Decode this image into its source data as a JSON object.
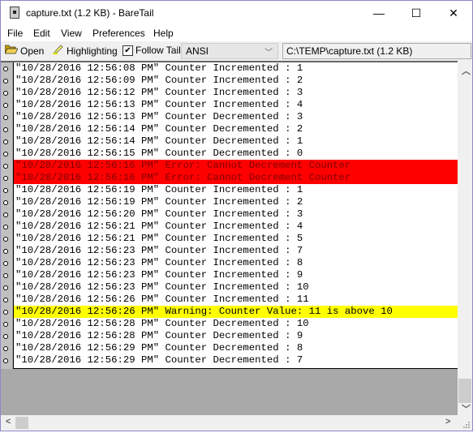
{
  "window": {
    "title": "capture.txt (1.2 KB) - BareTail",
    "minimize": "—",
    "maximize": "☐",
    "close": "✕"
  },
  "menu": [
    "File",
    "Edit",
    "View",
    "Preferences",
    "Help"
  ],
  "toolbar": {
    "open_label": "Open",
    "highlighting_label": "Highlighting",
    "follow_tail_label": "Follow Tail",
    "follow_tail_checked": true,
    "encoding": "ANSI",
    "file_path": "C:\\TEMP\\capture.txt (1.2 KB)"
  },
  "colors": {
    "error_bg": "#ff0000",
    "error_fg": "#800000",
    "warning_bg": "#ffff00"
  },
  "log_lines": [
    {
      "text": "\"10/28/2016 12:56:08 PM\" Counter Incremented : 1",
      "type": "normal"
    },
    {
      "text": "\"10/28/2016 12:56:09 PM\" Counter Incremented : 2",
      "type": "normal"
    },
    {
      "text": "\"10/28/2016 12:56:12 PM\" Counter Incremented : 3",
      "type": "normal"
    },
    {
      "text": "\"10/28/2016 12:56:13 PM\" Counter Incremented : 4",
      "type": "normal"
    },
    {
      "text": "\"10/28/2016 12:56:13 PM\" Counter Decremented : 3",
      "type": "normal"
    },
    {
      "text": "\"10/28/2016 12:56:14 PM\" Counter Decremented : 2",
      "type": "normal"
    },
    {
      "text": "\"10/28/2016 12:56:14 PM\" Counter Decremented : 1",
      "type": "normal"
    },
    {
      "text": "\"10/28/2016 12:56:15 PM\" Counter Decremented : 0",
      "type": "normal"
    },
    {
      "text": "\"10/28/2016 12:56:16 PM\" Error: Cannot Decrement Counter",
      "type": "error"
    },
    {
      "text": "\"10/28/2016 12:56:16 PM\" Error: Cannot Decrement Counter",
      "type": "error"
    },
    {
      "text": "\"10/28/2016 12:56:19 PM\" Counter Incremented : 1",
      "type": "normal"
    },
    {
      "text": "\"10/28/2016 12:56:19 PM\" Counter Incremented : 2",
      "type": "normal"
    },
    {
      "text": "\"10/28/2016 12:56:20 PM\" Counter Incremented : 3",
      "type": "normal"
    },
    {
      "text": "\"10/28/2016 12:56:21 PM\" Counter Incremented : 4",
      "type": "normal"
    },
    {
      "text": "\"10/28/2016 12:56:21 PM\" Counter Incremented : 5",
      "type": "normal"
    },
    {
      "text": "\"10/28/2016 12:56:23 PM\" Counter Incremented : 7",
      "type": "normal"
    },
    {
      "text": "\"10/28/2016 12:56:23 PM\" Counter Incremented : 8",
      "type": "normal"
    },
    {
      "text": "\"10/28/2016 12:56:23 PM\" Counter Incremented : 9",
      "type": "normal"
    },
    {
      "text": "\"10/28/2016 12:56:23 PM\" Counter Incremented : 10",
      "type": "normal"
    },
    {
      "text": "\"10/28/2016 12:56:26 PM\" Counter Incremented : 11",
      "type": "normal"
    },
    {
      "text": "\"10/28/2016 12:56:26 PM\" Warning: Counter Value: 11 is above 10",
      "type": "warning"
    },
    {
      "text": "\"10/28/2016 12:56:28 PM\" Counter Decremented : 10",
      "type": "normal"
    },
    {
      "text": "\"10/28/2016 12:56:28 PM\" Counter Decremented : 9",
      "type": "normal"
    },
    {
      "text": "\"10/28/2016 12:56:29 PM\" Counter Decremented : 8",
      "type": "normal"
    },
    {
      "text": "\"10/28/2016 12:56:29 PM\" Counter Decremented : 7",
      "type": "normal"
    }
  ],
  "scrollbars": {
    "up": "^",
    "down": "v",
    "left": "<",
    "right": ">"
  }
}
